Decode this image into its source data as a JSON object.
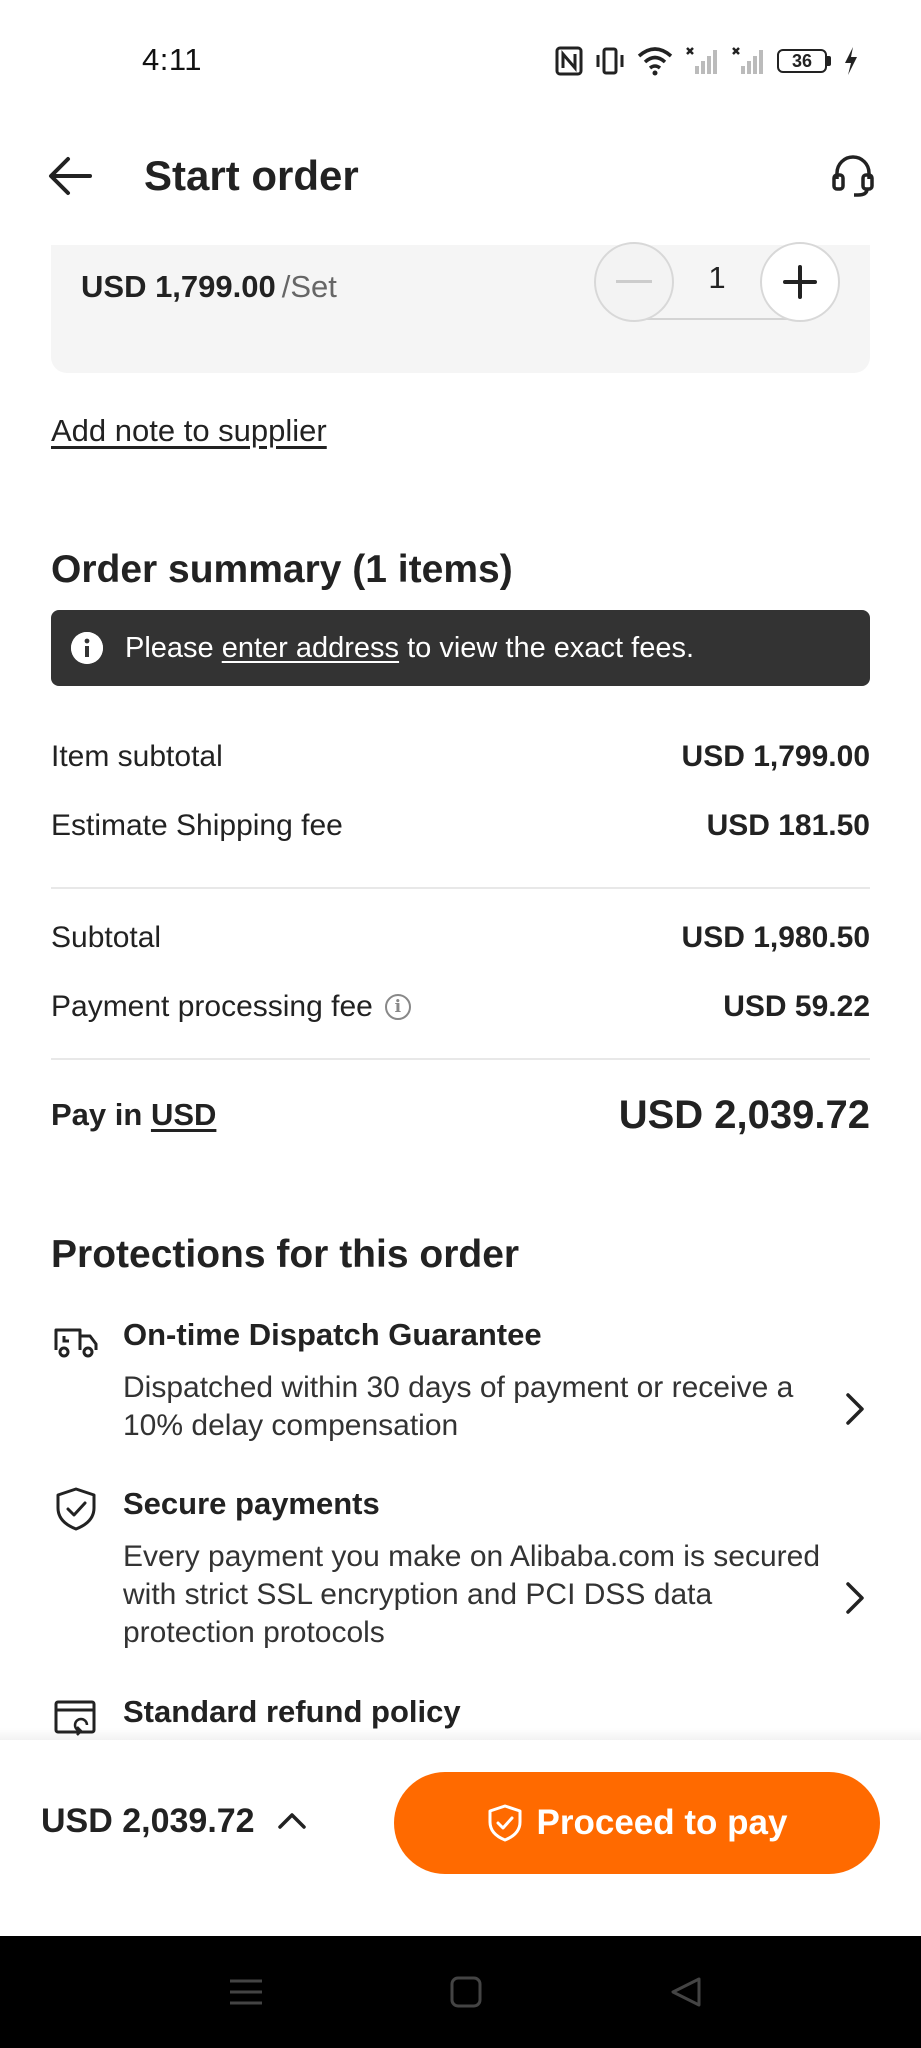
{
  "status_bar": {
    "time": "4:11",
    "battery": "36",
    "icons": [
      "nfc-icon",
      "vibrate-icon",
      "wifi-icon",
      "signal-no-service-icon",
      "signal-no-service-icon",
      "battery-icon",
      "charging-icon"
    ]
  },
  "header": {
    "title": "Start order",
    "back_icon": "arrow-left-icon",
    "support_icon": "headset-icon"
  },
  "product": {
    "price": "USD 1,799.00",
    "unit": "/Set",
    "quantity": "1"
  },
  "add_note_label": "Add note to supplier",
  "order_summary": {
    "title": "Order summary (1 items)",
    "notice": {
      "prefix": "Please ",
      "link": "enter address",
      "suffix": " to view the exact fees."
    },
    "rows": [
      {
        "label": "Item subtotal",
        "value": "USD 1,799.00"
      },
      {
        "label": "Estimate Shipping fee",
        "value": "USD 181.50"
      },
      {
        "label": "Subtotal",
        "value": "USD 1,980.50"
      },
      {
        "label": "Payment processing fee",
        "value": "USD 59.22"
      }
    ],
    "pay_in_prefix": "Pay in ",
    "pay_currency": "USD",
    "pay_total": "USD 2,039.72"
  },
  "protections": {
    "title": "Protections for this order",
    "items": [
      {
        "title": "On-time Dispatch Guarantee",
        "desc": "Dispatched within 30 days of payment or receive a 10% delay compensation",
        "icon": "truck-clock-icon"
      },
      {
        "title": "Secure payments",
        "desc": "Every payment you make on Alibaba.com is secured with strict SSL encryption and PCI DSS data protection protocols",
        "icon": "shield-check-icon"
      },
      {
        "title": "Standard refund policy",
        "desc": "",
        "icon": "card-refund-icon"
      }
    ]
  },
  "bottom_bar": {
    "total": "USD 2,039.72",
    "button_label": "Proceed to pay"
  },
  "colors": {
    "accent": "#ff6a00",
    "notice_bg": "#333333",
    "card_bg": "#f5f5f5"
  }
}
